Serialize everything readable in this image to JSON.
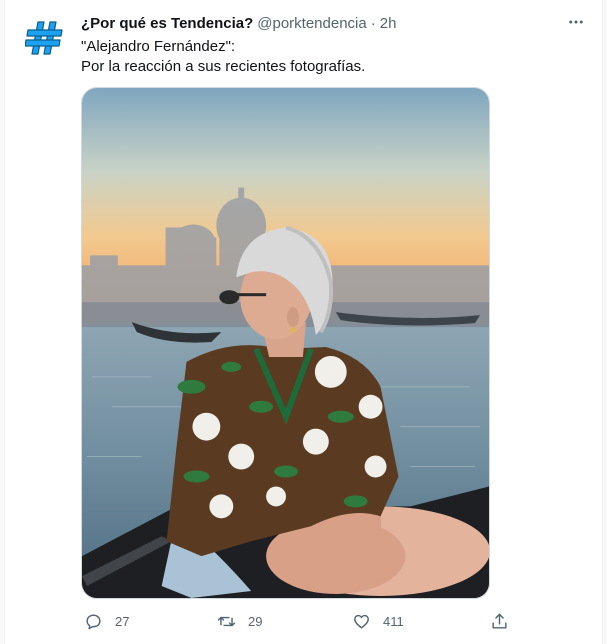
{
  "tweet": {
    "author": {
      "display_name": "¿Por qué es Tendencia?",
      "handle": "@porktendencia",
      "separator": "·",
      "time": "2h",
      "avatar_icon": "hashtag-icon",
      "avatar_color": "#1da1f2"
    },
    "text": {
      "line1": "\"Alejandro Fernández\":",
      "line2": "Por la reacción a sus recientes fotografías."
    },
    "media": {
      "description_icon": "photo-image"
    },
    "actions": {
      "reply": {
        "icon": "reply-icon",
        "count": "27"
      },
      "retweet": {
        "icon": "retweet-icon",
        "count": "29"
      },
      "like": {
        "icon": "heart-icon",
        "count": "411"
      },
      "share": {
        "icon": "share-icon"
      }
    },
    "more_icon": "more-dots-icon"
  },
  "colors": {
    "text_primary": "#0f1419",
    "text_secondary": "#536471",
    "border": "#cfd9de"
  }
}
